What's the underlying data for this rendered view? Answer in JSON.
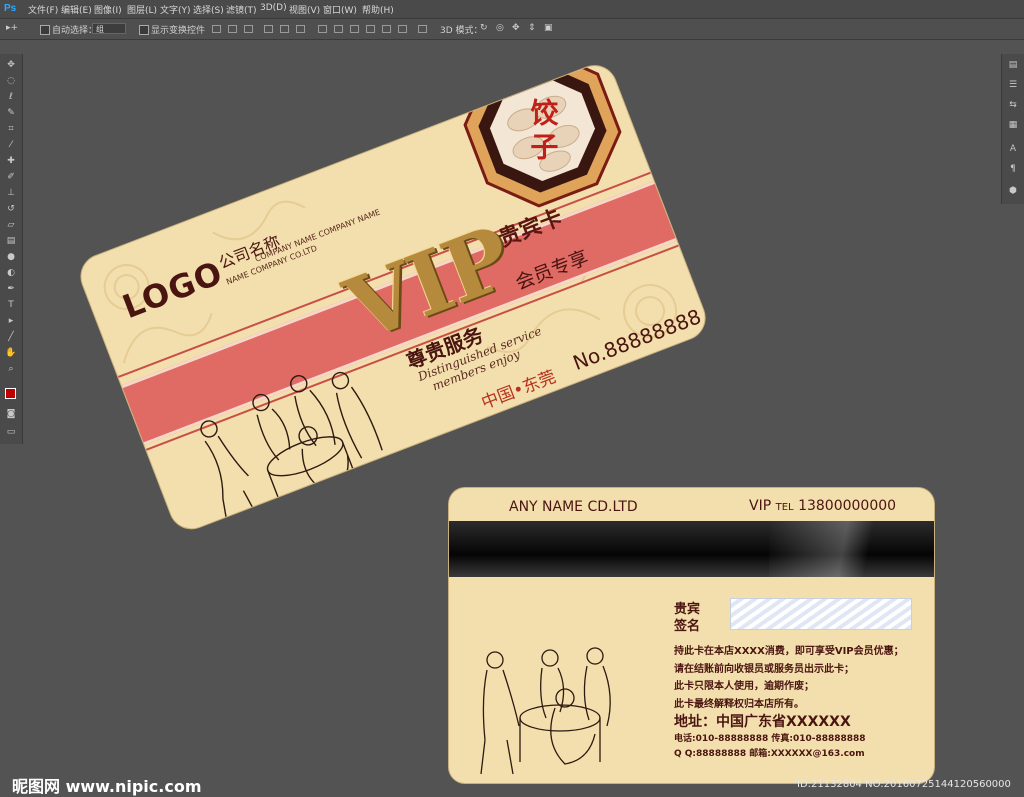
{
  "app": {
    "logo": "Ps",
    "menu": [
      "文件(F)",
      "编辑(E)",
      "图像(I)",
      "图层(L)",
      "文字(Y)",
      "选择(S)",
      "滤镜(T)",
      "3D(D)",
      "视图(V)",
      "窗口(W)",
      "帮助(H)"
    ]
  },
  "options": {
    "auto_select_label": "自动选择：",
    "auto_select_value": "组",
    "show_transform_label": "显示变换控件",
    "mode_3d_label": "3D 模式："
  },
  "front_card": {
    "logo": "LOGO",
    "company_cn": "公司名称",
    "company_en_1": "COMPANY NAME COMPANY NAME",
    "company_en_2": "NAME COMPANY CO.LTD",
    "vip": "VIP",
    "guibin": "贵宾卡",
    "service": "尊贵服务",
    "members_only": "会员专享",
    "distinguished": "Distinguished service",
    "members_enjoy": "members enjoy",
    "location": "中国•东莞",
    "card_no": "No.88888888",
    "dumpling": "饺子"
  },
  "back_card": {
    "company_name": "ANY NAME CD.LTD",
    "vip_label": "VIP",
    "tel_label": "TEL",
    "tel_number": "13800000000",
    "signature_1": "贵宾",
    "signature_2": "签名",
    "terms": [
      "持此卡在本店XXXX消费，即可享受VIP会员优惠；",
      "请在结账前向收银员或服务员出示此卡；",
      "此卡只限本人使用，逾期作废；",
      "此卡最终解释权归本店所有。"
    ],
    "address": "地址：中国广东省XXXXXX",
    "phone": "电话:010-88888888  传真:010-88888888",
    "qq": "Q Q:88888888  邮箱:XXXXXX@163.com"
  },
  "watermark": {
    "brand": "昵图网 www.nipic.com",
    "id": "ID:21132804 NO:20160725144120560000"
  }
}
